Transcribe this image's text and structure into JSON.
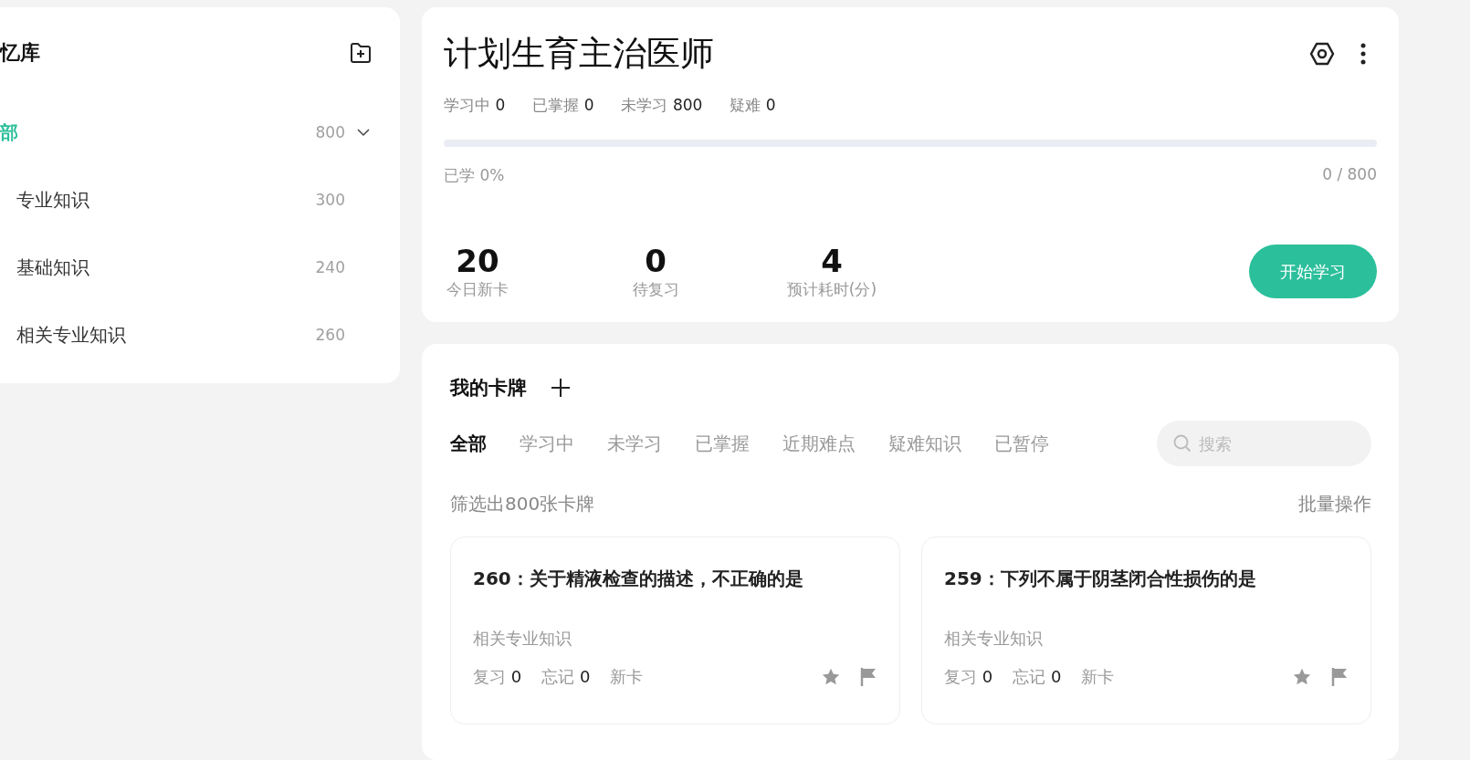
{
  "library": {
    "title": "忆库",
    "items": [
      {
        "label": "部",
        "count": "800",
        "selected": true,
        "expanded": true,
        "children": [
          {
            "label": "专业知识",
            "count": "300",
            "selected": false
          },
          {
            "label": "基础知识",
            "count": "240",
            "selected": false
          },
          {
            "label": "相关专业知识",
            "count": "260",
            "selected": false
          }
        ]
      }
    ]
  },
  "deck": {
    "title": "计划生育主治医师",
    "stats": [
      {
        "label": "学习中",
        "value": "0"
      },
      {
        "label": "已掌握",
        "value": "0"
      },
      {
        "label": "未学习",
        "value": "800"
      },
      {
        "label": "疑难",
        "value": "0"
      }
    ],
    "progress": {
      "level": 0,
      "label": "已学 0%",
      "reading": "0 / 800"
    },
    "summary": [
      {
        "value": "20",
        "label": "今日新卡"
      },
      {
        "value": "0",
        "label": "待复习"
      },
      {
        "value": "4",
        "label": "预计耗时(分)"
      }
    ],
    "start_button": "开始学习"
  },
  "cards": {
    "title": "我的卡牌",
    "tabs": [
      {
        "label": "全部",
        "selected": true
      },
      {
        "label": "学习中",
        "selected": false
      },
      {
        "label": "未学习",
        "selected": false
      },
      {
        "label": "已掌握",
        "selected": false
      },
      {
        "label": "近期难点",
        "selected": false
      },
      {
        "label": "疑难知识",
        "selected": false
      },
      {
        "label": "已暂停",
        "selected": false
      }
    ],
    "search": {
      "placeholder": "搜索"
    },
    "filter_text": "筛选出800张卡牌",
    "batch_button": "批量操作",
    "items": [
      {
        "title": "260：关于精液检查的描述，不正确的是",
        "category": "相关专业知识",
        "review_label": "复习",
        "review": "0",
        "forget_label": "忘记",
        "forget": "0",
        "status": "新卡"
      },
      {
        "title": "259：下列不属于阴茎闭合性损伤的是",
        "category": "相关专业知识",
        "review_label": "复习",
        "review": "0",
        "forget_label": "忘记",
        "forget": "0",
        "status": "新卡"
      }
    ]
  }
}
